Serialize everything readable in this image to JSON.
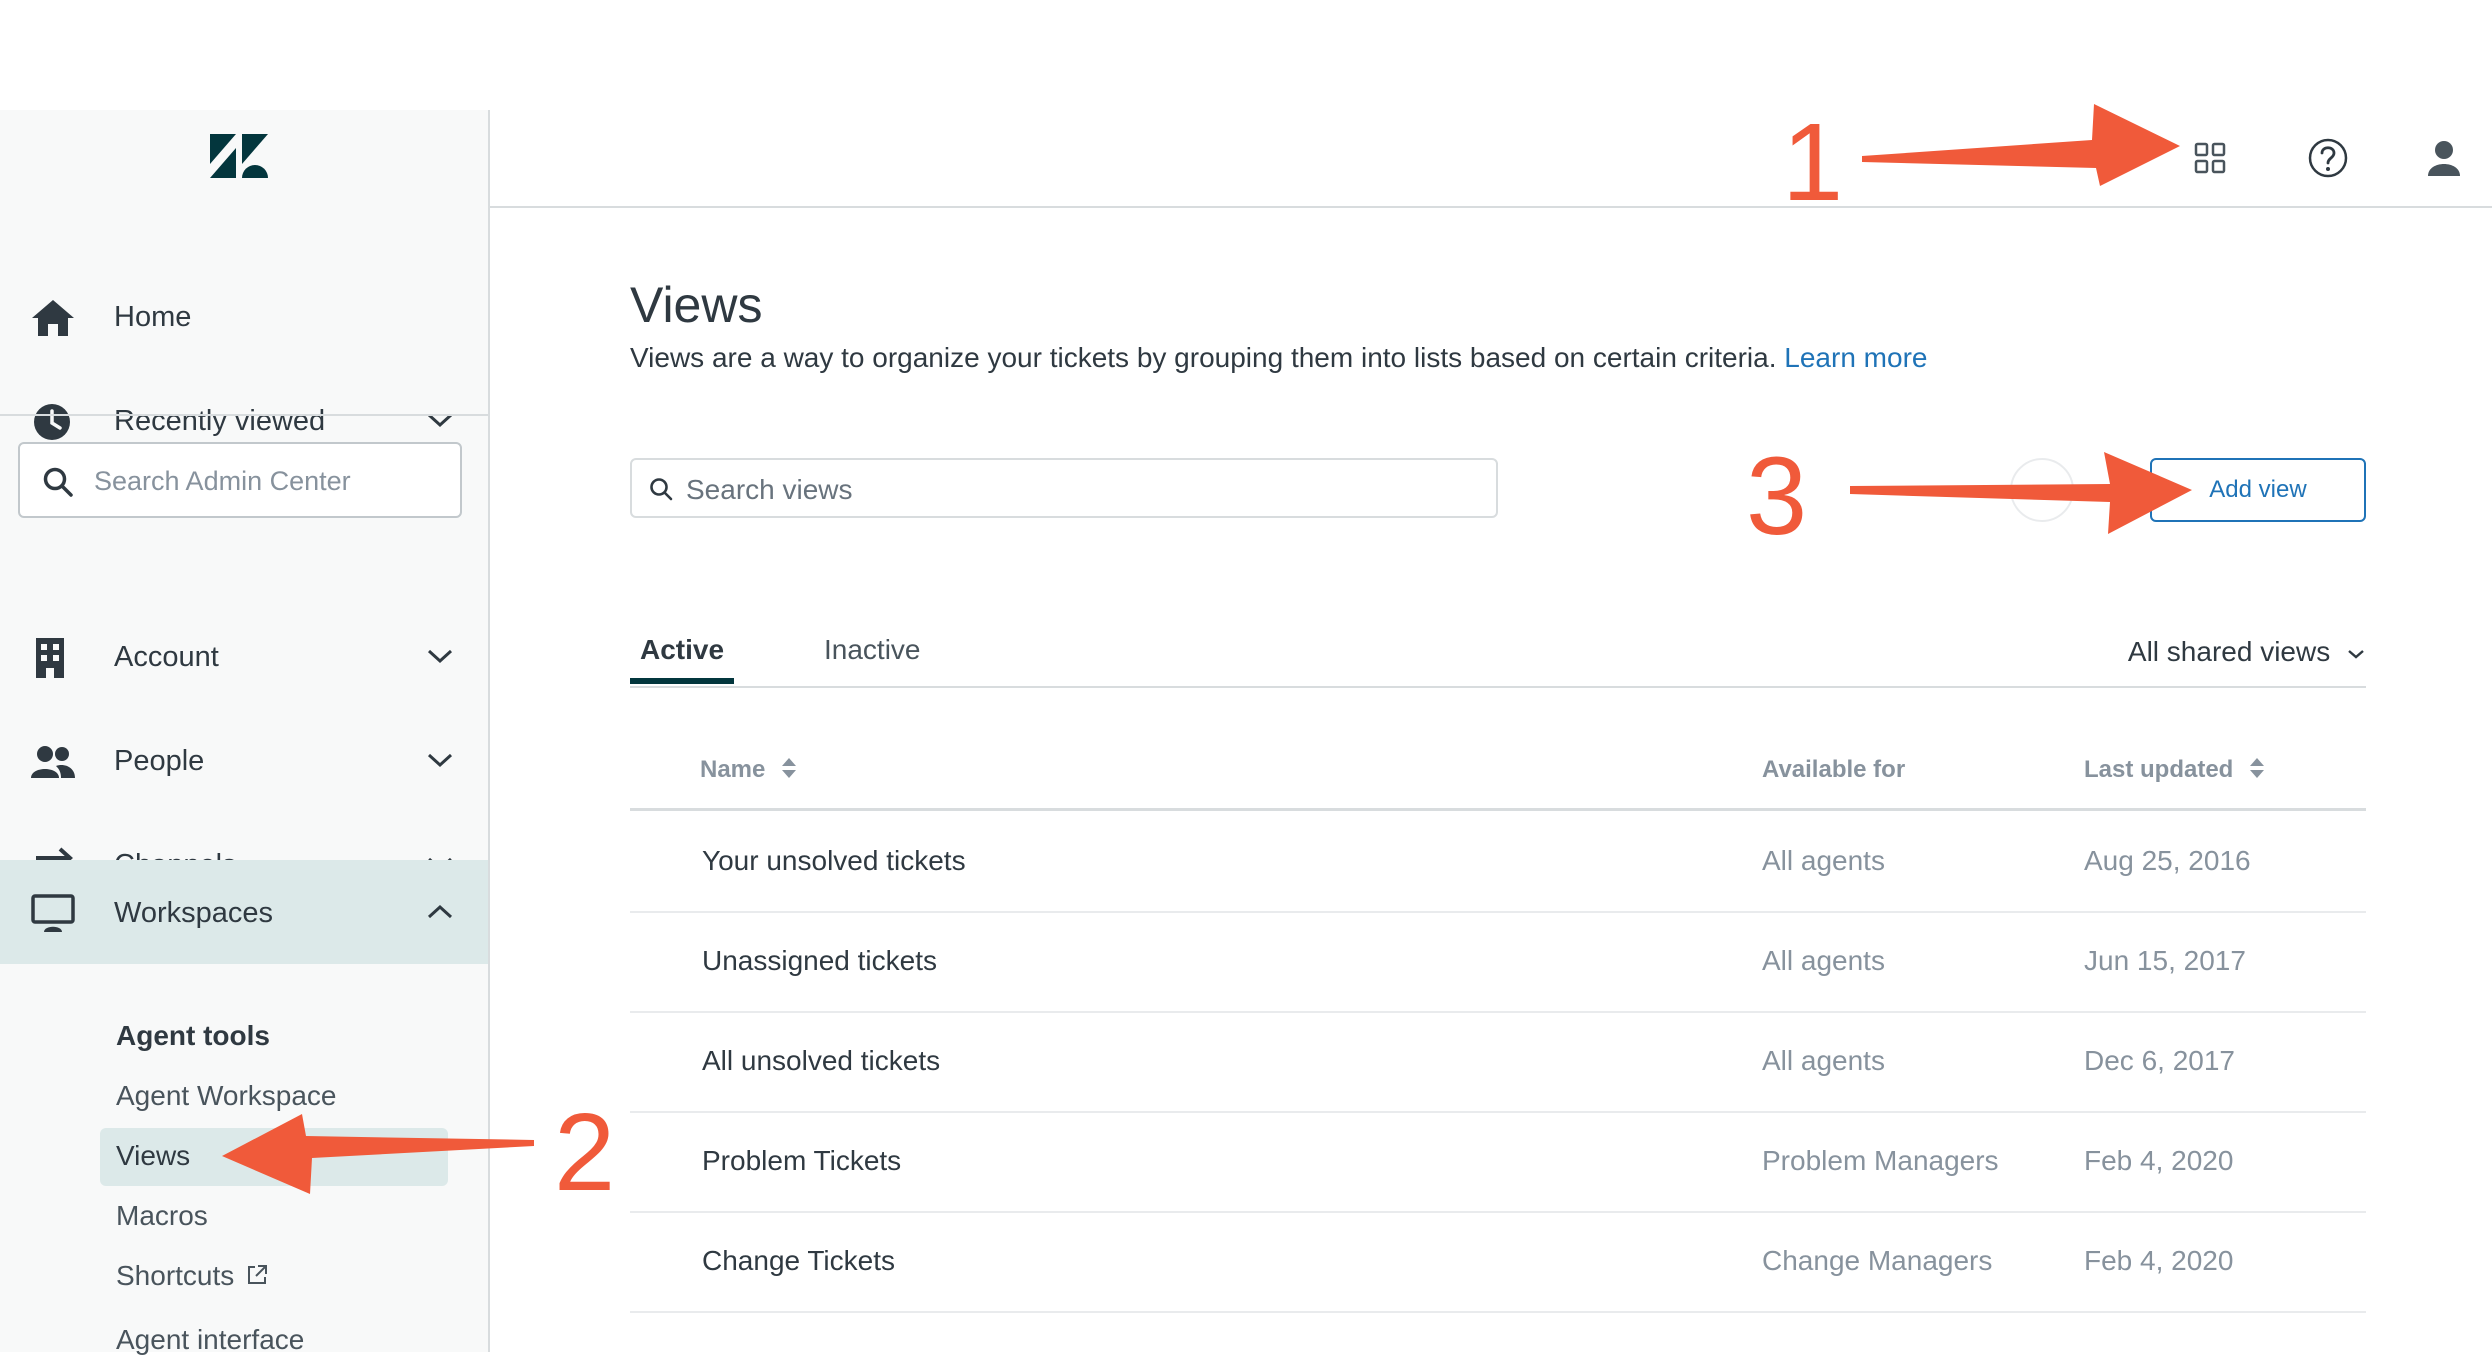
{
  "sidebar": {
    "logo": "zendesk-logo",
    "items": [
      {
        "label": "Home",
        "icon": "home-icon"
      },
      {
        "label": "Recently viewed",
        "icon": "clock-icon"
      },
      {
        "label": "Account",
        "icon": "building-icon"
      },
      {
        "label": "People",
        "icon": "people-icon"
      },
      {
        "label": "Channels",
        "icon": "channels-arrows-icon"
      },
      {
        "label": "Workspaces",
        "icon": "monitor-icon"
      }
    ],
    "search_placeholder": "Search Admin Center",
    "submenu": {
      "heading": "Agent tools",
      "items": [
        "Agent Workspace",
        "Views",
        "Macros",
        "Shortcuts"
      ],
      "next_heading": "Agent interface"
    }
  },
  "topbar": {
    "icons": [
      "products-grid-icon",
      "help-icon",
      "user-icon"
    ]
  },
  "main": {
    "title": "Views",
    "description": "Views are a way to organize your tickets by grouping them into lists based on certain criteria.",
    "learn_more": "Learn more",
    "search_placeholder": "Search views",
    "add_button": "Add view",
    "tabs": [
      "Active",
      "Inactive"
    ],
    "filter": "All shared views",
    "columns": [
      "Name",
      "Available for",
      "Last updated"
    ],
    "rows": [
      {
        "name": "Your unsolved tickets",
        "available": "All agents",
        "updated": "Aug 25, 2016"
      },
      {
        "name": "Unassigned tickets",
        "available": "All agents",
        "updated": "Jun 15, 2017"
      },
      {
        "name": "All unsolved tickets",
        "available": "All agents",
        "updated": "Dec 6, 2017"
      },
      {
        "name": "Problem Tickets",
        "available": "Problem Managers",
        "updated": "Feb 4, 2020"
      },
      {
        "name": "Change Tickets",
        "available": "Change Managers",
        "updated": "Feb 4, 2020"
      }
    ]
  },
  "annotations": {
    "numbers": [
      "1",
      "2",
      "3"
    ],
    "color": "#f05a3a"
  },
  "colors": {
    "accent_blue": "#1f73b7",
    "active_bg": "#dce9e9",
    "tab_underline": "#03363d"
  }
}
